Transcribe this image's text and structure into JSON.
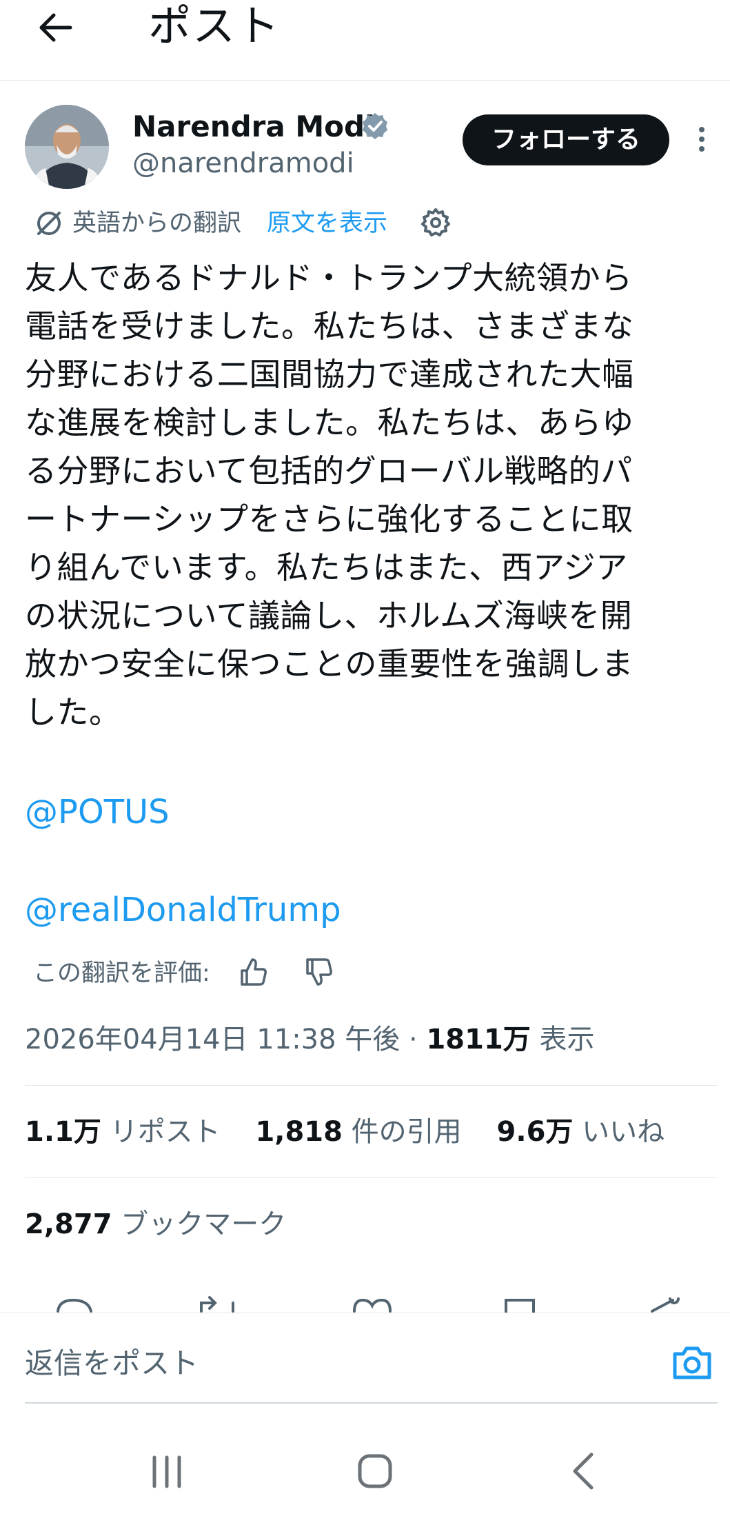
{
  "header": {
    "title": "ポスト"
  },
  "author": {
    "name": "Narendra Modi",
    "handle": "@narendramodi",
    "follow_label": "フォローする"
  },
  "translation": {
    "label": "英語からの翻訳",
    "show_original": "原文を表示"
  },
  "post": {
    "lines": [
      "友人であるドナルド・トランプ大統領から",
      "電話を受けました。私たちは、さまざまな",
      "分野における二国間協力で達成された大幅",
      "な進展を検討しました。私たちは、あらゆ",
      "る分野において包括的グローバル戦略的パ",
      "ートナーシップをさらに強化することに取",
      "り組んでいます。私たちはまた、西アジア",
      "の状況について議論し、ホルムズ海峡を開",
      "放かつ安全に保つことの重要性を強調しま",
      "した。"
    ],
    "mentions": [
      "@POTUS",
      "@realDonaldTrump"
    ]
  },
  "rating": {
    "label": "この翻訳を評価:"
  },
  "meta": {
    "timestamp": "2026年04月14日 11:38 午後 · ",
    "views_count": "1811万",
    "views_label": " 表示"
  },
  "stats": {
    "reposts_count": "1.1万",
    "reposts_label": " リポスト",
    "quotes_count": "1,818",
    "quotes_label": " 件の引用",
    "likes_count": "9.6万",
    "likes_label": " いいね",
    "bookmarks_count": "2,877",
    "bookmarks_label": " ブックマーク"
  },
  "reply": {
    "placeholder": "返信をポスト"
  },
  "icons": [
    "back-arrow-icon",
    "verified-badge-icon",
    "more-icon",
    "translate-icon",
    "settings-gear-icon",
    "thumbs-up-icon",
    "thumbs-down-icon",
    "camera-icon",
    "recent-apps-icon",
    "home-icon",
    "nav-back-icon"
  ],
  "colors": {
    "link": "#1d9bf0",
    "text": "#0f1419",
    "secondary": "#536471",
    "verified": "#829aab"
  }
}
